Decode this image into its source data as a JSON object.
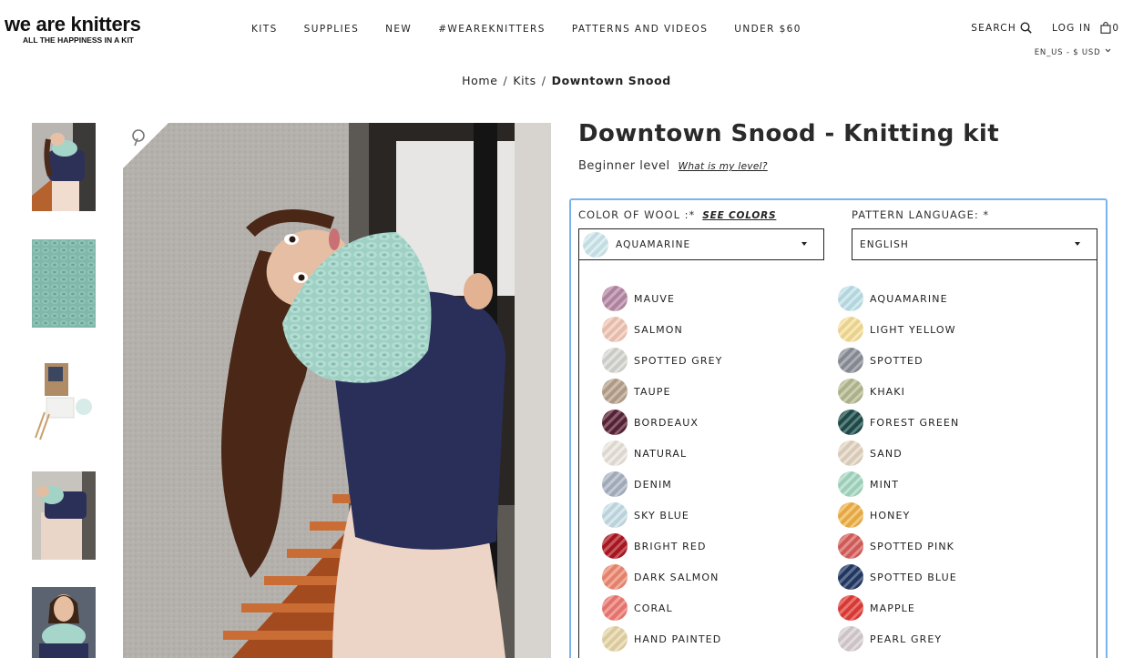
{
  "header": {
    "logo_title": "we are knitters",
    "logo_tagline": "ALL THE HAPPINESS IN A KIT",
    "nav": [
      {
        "label": "KITS",
        "name": "nav-kits"
      },
      {
        "label": "SUPPLIES",
        "name": "nav-supplies"
      },
      {
        "label": "NEW",
        "name": "nav-new"
      },
      {
        "label": "#WEAREKNITTERS",
        "name": "nav-weareknitters"
      },
      {
        "label": "PATTERNS AND VIDEOS",
        "name": "nav-patterns-and-videos"
      },
      {
        "label": "UNDER $60",
        "name": "nav-under-60"
      }
    ],
    "search_label": "SEARCH",
    "login_label": "LOG IN",
    "cart_count": "0",
    "locale": "EN_US - $ USD"
  },
  "breadcrumb": {
    "home": "Home",
    "kits": "Kits",
    "current": "Downtown Snood",
    "separator": "/"
  },
  "gallery": {
    "thumbnails": [
      "snood-model-thumb",
      "knit-texture-thumb",
      "kit-contents-thumb",
      "model-leaning-thumb",
      "model-closeup-thumb"
    ]
  },
  "product": {
    "title": "Downtown Snood - Knitting kit",
    "level": "Beginner level",
    "level_link": "What is my level?",
    "color_label": "COLOR OF WOOL :*",
    "see_colors": "SEE COLORS",
    "language_label": "PATTERN LANGUAGE: *",
    "selected_color": "AQUAMARINE",
    "selected_color_hex": "#cfe9ef",
    "selected_language": "ENGLISH",
    "accent_border": "#7ab3ee",
    "colors_left": [
      {
        "name": "MAUVE",
        "hex": "#b98aa6"
      },
      {
        "name": "SALMON",
        "hex": "#f2c7b7"
      },
      {
        "name": "SPOTTED GREY",
        "hex": "#d7d7d2"
      },
      {
        "name": "TAUPE",
        "hex": "#b9a48c"
      },
      {
        "name": "BORDEAUX",
        "hex": "#5a2337"
      },
      {
        "name": "NATURAL",
        "hex": "#ebe5dc"
      },
      {
        "name": "DENIM",
        "hex": "#aab4c2"
      },
      {
        "name": "SKY BLUE",
        "hex": "#c8dfe8"
      },
      {
        "name": "BRIGHT RED",
        "hex": "#b01722"
      },
      {
        "name": "DARK SALMON",
        "hex": "#ef8a73"
      },
      {
        "name": "CORAL",
        "hex": "#ef7b74"
      },
      {
        "name": "HAND PAINTED",
        "hex": "#e7d6a8"
      }
    ],
    "colors_right": [
      {
        "name": "AQUAMARINE",
        "hex": "#bfe2ea"
      },
      {
        "name": "LIGHT YELLOW",
        "hex": "#f7df98"
      },
      {
        "name": "SPOTTED",
        "hex": "#8c9099"
      },
      {
        "name": "KHAKI",
        "hex": "#b7bc93"
      },
      {
        "name": "FOREST GREEN",
        "hex": "#1f4e4c"
      },
      {
        "name": "SAND",
        "hex": "#e4d6c3"
      },
      {
        "name": "MINT",
        "hex": "#a7d9c3"
      },
      {
        "name": "HONEY",
        "hex": "#f1b34a"
      },
      {
        "name": "SPOTTED PINK",
        "hex": "#d9615e"
      },
      {
        "name": "SPOTTED BLUE",
        "hex": "#233a66"
      },
      {
        "name": "MAPPLE",
        "hex": "#e23d38"
      },
      {
        "name": "PEARL GREY",
        "hex": "#d8cfd3"
      }
    ]
  }
}
